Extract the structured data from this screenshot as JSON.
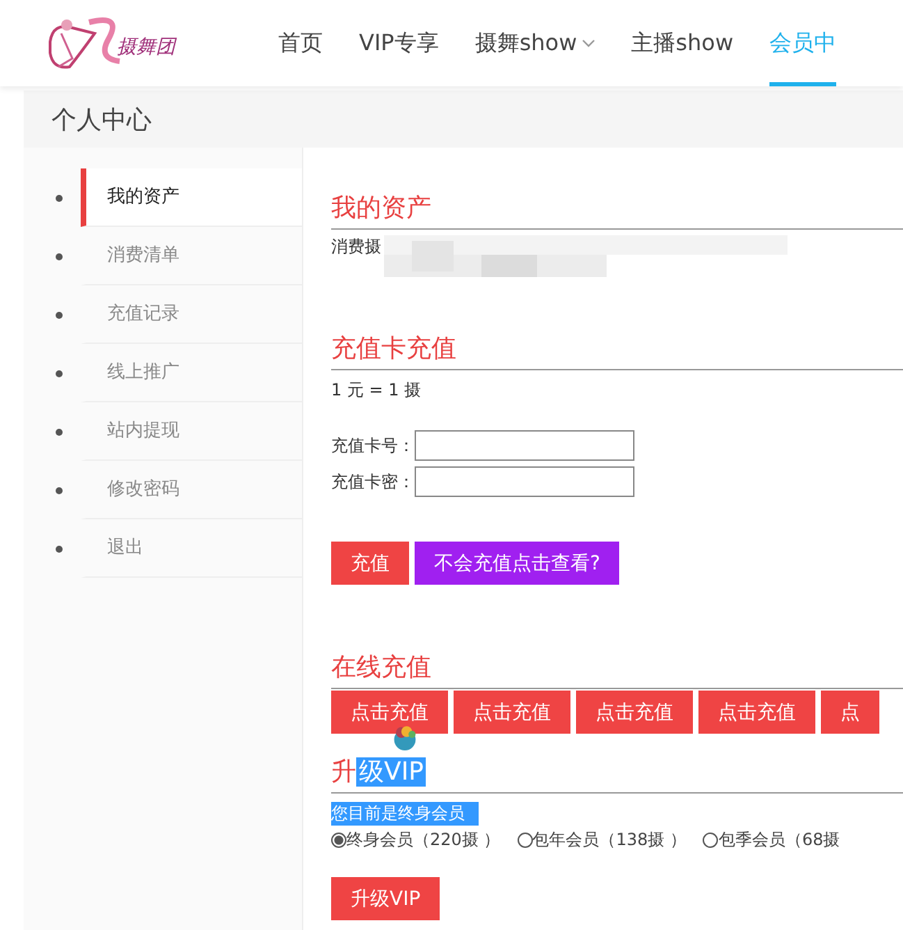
{
  "logo": {
    "text": "摄舞团"
  },
  "nav": [
    {
      "label": "首页",
      "selected": false,
      "dropdown": false
    },
    {
      "label": "VIP专享",
      "selected": false,
      "dropdown": false
    },
    {
      "label": "摄舞show",
      "selected": false,
      "dropdown": true
    },
    {
      "label": "主播show",
      "selected": false,
      "dropdown": false
    },
    {
      "label": "会员中",
      "selected": true,
      "dropdown": false
    }
  ],
  "page_title": "个人中心",
  "sidebar": {
    "items": [
      {
        "label": "我的资产",
        "selected": true
      },
      {
        "label": "消费清单",
        "selected": false
      },
      {
        "label": "充值记录",
        "selected": false
      },
      {
        "label": "线上推广",
        "selected": false
      },
      {
        "label": "站内提现",
        "selected": false
      },
      {
        "label": "修改密码",
        "selected": false
      },
      {
        "label": "退出",
        "selected": false
      }
    ]
  },
  "assets": {
    "title": "我的资产",
    "balance_label": "消费摄"
  },
  "card_recharge": {
    "title": "充值卡充值",
    "rate": "1 元 = 1 摄",
    "fields": [
      {
        "label": "充值卡号："
      },
      {
        "label": "充值卡密："
      }
    ],
    "buttons": [
      {
        "label": "充值",
        "kind": "primary"
      },
      {
        "label": "不会充值点击查看?",
        "kind": "help"
      }
    ]
  },
  "online_recharge": {
    "title": "在线充值",
    "buttons": [
      "点击充值",
      "点击充值",
      "点击充值",
      "点击充值",
      "点"
    ]
  },
  "upgrade": {
    "title": "升",
    "title_selected_part": "级VIP",
    "status": "您目前是终身会员",
    "status_selected": true,
    "options": [
      {
        "label": "终身会员（220摄 ）",
        "selected": true
      },
      {
        "label": "包年会员（138摄 ）",
        "selected": false
      },
      {
        "label": "包季会员（68摄",
        "selected": false
      }
    ],
    "button": "升级VIP"
  }
}
